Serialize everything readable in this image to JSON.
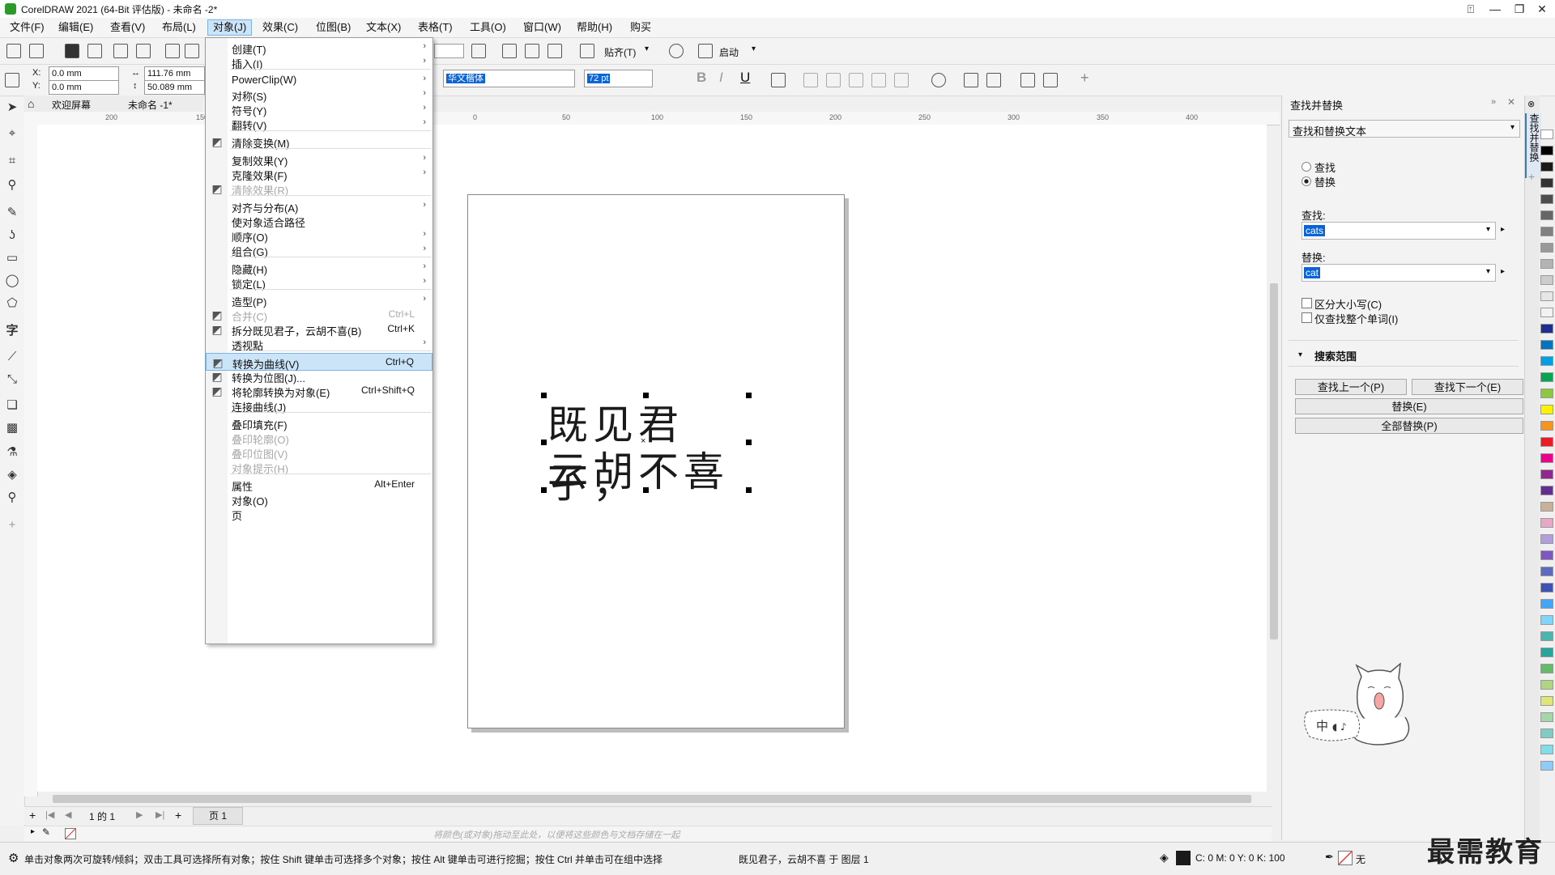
{
  "window": {
    "title": "CorelDRAW 2021 (64-Bit 评估版) - 未命名 -2*"
  },
  "menubar": [
    "文件(F)",
    "编辑(E)",
    "查看(V)",
    "布局(L)",
    "对象(J)",
    "效果(C)",
    "位图(B)",
    "文本(X)",
    "表格(T)",
    "工具(O)",
    "窗口(W)",
    "帮助(H)",
    "购买"
  ],
  "toolbar": {
    "snap_label": "贴齐(T)",
    "launch_label": "启动"
  },
  "property_bar": {
    "x_label": "X:",
    "y_label": "Y:",
    "x_value": "0.0 mm",
    "y_value": "0.0 mm",
    "w_value": "111.76 mm",
    "h_value": "50.089 mm",
    "font_name": "华文楷体",
    "font_size": "72 pt"
  },
  "doc_tabs": {
    "welcome": "欢迎屏幕",
    "doc": "未命名 -1*"
  },
  "ruler": {
    "h_ticks": [
      "200",
      "150",
      "0",
      "50",
      "100",
      "150",
      "200",
      "250",
      "300",
      "350",
      "400"
    ]
  },
  "canvas_text": {
    "line1": "既见君子，",
    "line2": "云胡不喜"
  },
  "object_menu": {
    "items": [
      {
        "label": "创建(T)",
        "arrow": true
      },
      {
        "label": "插入(I)",
        "arrow": true
      },
      {
        "label": "PowerClip(W)",
        "arrow": true,
        "sep_before": true
      },
      {
        "label": "对称(S)",
        "arrow": true
      },
      {
        "label": "符号(Y)",
        "arrow": true
      },
      {
        "label": "翻转(V)",
        "arrow": true
      },
      {
        "label": "清除变换(M)",
        "sep_before": true,
        "icon": "clear-transform-icon"
      },
      {
        "label": "复制效果(Y)",
        "arrow": true,
        "sep_before": true
      },
      {
        "label": "克隆效果(F)",
        "arrow": true
      },
      {
        "label": "清除效果(R)",
        "disabled": true,
        "icon": "clear-effect-icon"
      },
      {
        "label": "对齐与分布(A)",
        "arrow": true,
        "sep_before": true
      },
      {
        "label": "使对象适合路径"
      },
      {
        "label": "顺序(O)",
        "arrow": true
      },
      {
        "label": "组合(G)",
        "arrow": true
      },
      {
        "label": "隐藏(H)",
        "arrow": true,
        "sep_before": true
      },
      {
        "label": "锁定(L)",
        "arrow": true
      },
      {
        "label": "造型(P)",
        "arrow": true,
        "sep_before": true
      },
      {
        "label": "合并(C)",
        "shortcut": "Ctrl+L",
        "disabled": true,
        "icon": "combine-icon"
      },
      {
        "label": "拆分既见君子，云胡不喜(B)",
        "shortcut": "Ctrl+K",
        "icon": "break-apart-icon"
      },
      {
        "label": "透视點",
        "arrow": true
      },
      {
        "label": "转换为曲线(V)",
        "shortcut": "Ctrl+Q",
        "highlight": true,
        "sep_before": true,
        "icon": "convert-curves-icon"
      },
      {
        "label": "转换为位图(J)...",
        "icon": "convert-bitmap-icon"
      },
      {
        "label": "将轮廓转换为对象(E)",
        "shortcut": "Ctrl+Shift+Q",
        "icon": "outline-object-icon"
      },
      {
        "label": "连接曲线(J)"
      },
      {
        "label": "叠印填充(F)",
        "sep_before": true
      },
      {
        "label": "叠印轮廓(O)",
        "disabled": true
      },
      {
        "label": "叠印位图(V)",
        "disabled": true
      },
      {
        "label": "对象提示(H)",
        "disabled": true
      },
      {
        "label": "属性",
        "shortcut": "Alt+Enter",
        "sep_before": true
      },
      {
        "label": "对象(O)"
      },
      {
        "label": "页"
      }
    ]
  },
  "docker": {
    "title": "查找并替换",
    "mode": "查找和替换文本",
    "radio_find": "查找",
    "radio_replace": "替换",
    "find_label": "查找:",
    "find_value": "cats",
    "replace_label": "替换:",
    "replace_value": "cat",
    "match_case": "区分大小写(C)",
    "whole_word": "仅查找整个单词(I)",
    "search_scope": "搜索范围",
    "find_prev": "查找上一个(P)",
    "find_next": "查找下一个(E)",
    "replace_btn": "替换(E)",
    "replace_all": "全部替换(P)",
    "side_tab": "查找并替换"
  },
  "page_nav": {
    "page_info": "1  的  1",
    "page_tab": "页 1"
  },
  "palette_hint": "将颜色(或对象)拖动至此处，以便将这些颜色与文档存储在一起",
  "status": {
    "hint": "单击对象两次可旋转/倾斜；双击工具可选择所有对象；按住 Shift 键单击可选择多个对象；按住 Alt 键单击可进行挖掘；按住 Ctrl 并单击可在组中选择",
    "object_info": "既见君子，云胡不喜 于 图层 1",
    "color_info": "C: 0 M: 0 Y: 0 K: 100",
    "none_label": "无"
  },
  "watermark": "最需教育",
  "colors": {
    "palette": [
      "#ffffff",
      "#000000",
      "#1a1a1a",
      "#333333",
      "#4d4d4d",
      "#666666",
      "#808080",
      "#999999",
      "#b3b3b3",
      "#cccccc",
      "#e6e6e6",
      "#f2f2f2",
      "#1f2f8f",
      "#0074c1",
      "#00a0e9",
      "#00a650",
      "#8dc63f",
      "#fff200",
      "#f7941d",
      "#ed1c24",
      "#ec008c",
      "#92278f",
      "#662d91",
      "#c7b299",
      "#e6a8c6",
      "#b39ddb",
      "#7e57c2",
      "#5c6bc0",
      "#3f51b5",
      "#42a5f5",
      "#81d4fa",
      "#4db6ac",
      "#26a69a",
      "#66bb6a",
      "#aed581",
      "#dce775",
      "#a5d6a7",
      "#80cbc4",
      "#80deea",
      "#90caf9"
    ]
  }
}
